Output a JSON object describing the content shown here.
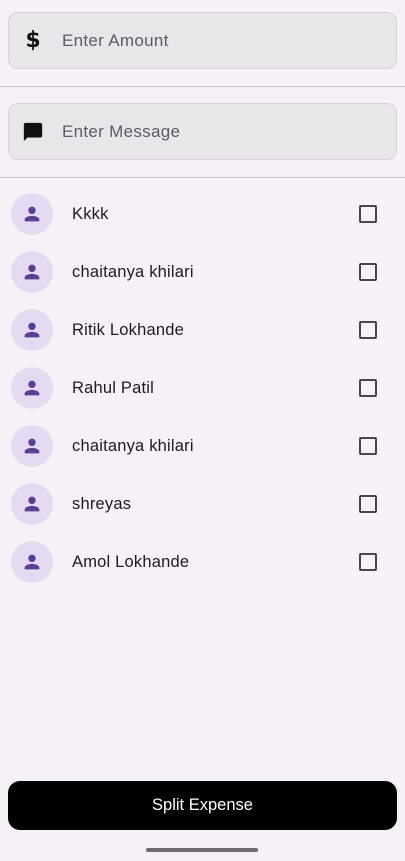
{
  "amount_field": {
    "placeholder": "Enter Amount",
    "value": "",
    "icon": "dollar-icon"
  },
  "message_field": {
    "placeholder": "Enter Message",
    "value": "",
    "icon": "message-icon"
  },
  "contacts": [
    {
      "name": "Kkkk",
      "checked": false
    },
    {
      "name": "chaitanya khilari",
      "checked": false
    },
    {
      "name": "Ritik Lokhande",
      "checked": false
    },
    {
      "name": "Rahul Patil",
      "checked": false
    },
    {
      "name": "chaitanya khilari",
      "checked": false
    },
    {
      "name": "shreyas",
      "checked": false
    },
    {
      "name": "Amol Lokhande",
      "checked": false
    }
  ],
  "split_button": {
    "label": "Split Expense"
  },
  "colors": {
    "background": "#f6f1f7",
    "field_fill": "#e8e6e9",
    "avatar_bg": "#e4dbf3",
    "avatar_icon": "#5b3f94",
    "button_bg": "#000000"
  }
}
